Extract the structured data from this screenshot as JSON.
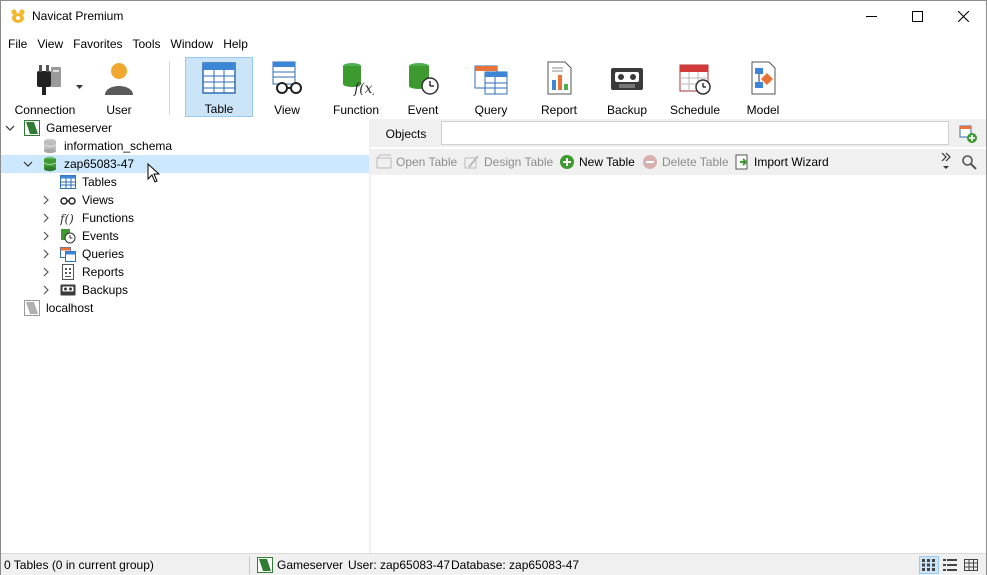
{
  "window": {
    "title": "Navicat Premium",
    "controls": {
      "minimize": "minimize",
      "maximize": "maximize",
      "close": "close"
    }
  },
  "menu": {
    "items": [
      "File",
      "View",
      "Favorites",
      "Tools",
      "Window",
      "Help"
    ]
  },
  "toolbar": {
    "connection": "Connection",
    "user": "User",
    "table": "Table",
    "view": "View",
    "function": "Function",
    "event": "Event",
    "query": "Query",
    "report": "Report",
    "backup": "Backup",
    "schedule": "Schedule",
    "model": "Model",
    "active": "Table"
  },
  "tree": {
    "connection": "Gameserver",
    "db_info_schema": "information_schema",
    "db_selected": "zap65083-47",
    "children": {
      "tables": "Tables",
      "views": "Views",
      "functions": "Functions",
      "events": "Events",
      "queries": "Queries",
      "reports": "Reports",
      "backups": "Backups"
    },
    "localhost": "localhost"
  },
  "objects": {
    "tab_label": "Objects",
    "buttons": {
      "open_table": "Open Table",
      "design_table": "Design Table",
      "new_table": "New Table",
      "delete_table": "Delete Table",
      "import_wizard": "Import Wizard"
    }
  },
  "status": {
    "left": "0 Tables (0 in current group)",
    "connection": "Gameserver",
    "user": "User: zap65083-47",
    "database": "Database: zap65083-47"
  },
  "colors": {
    "selection": "#cce8ff",
    "toolbar_active": "#cce4f7",
    "db_green": "#3c9a2f",
    "bar_gray": "#f0f0f0"
  }
}
